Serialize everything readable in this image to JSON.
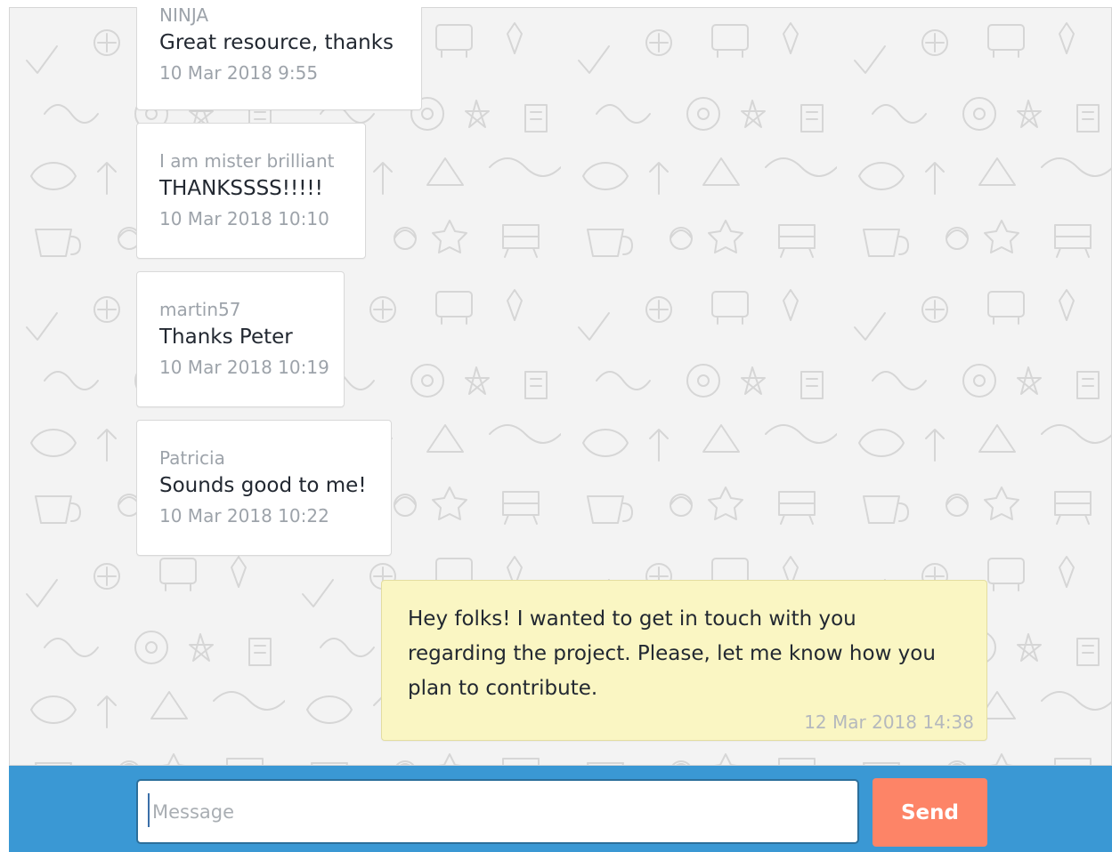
{
  "messages": [
    {
      "author": "NINJA",
      "text": "Great resource, thanks",
      "time": "10 Mar 2018 9:55"
    },
    {
      "author": "I am mister brilliant",
      "text": "THANKSSSS!!!!!",
      "time": "10 Mar 2018 10:10"
    },
    {
      "author": "martin57",
      "text": "Thanks Peter",
      "time": "10 Mar 2018 10:19"
    },
    {
      "author": "Patricia",
      "text": "Sounds good to me!",
      "time": "10 Mar 2018 10:22"
    }
  ],
  "own_message": {
    "text": "Hey folks! I wanted to get in touch with you regarding the project. Please, let me know how you plan to contribute.",
    "time": "12 Mar 2018 14:38"
  },
  "composer": {
    "placeholder": "Message",
    "value": "",
    "send_label": "Send"
  },
  "colors": {
    "composer_bar": "#3a98d4",
    "send_button": "#fd8467",
    "own_bubble": "#faf6c3",
    "chat_background": "#f3f3f3"
  },
  "icons": {
    "background_pattern": "doodle-pattern"
  }
}
